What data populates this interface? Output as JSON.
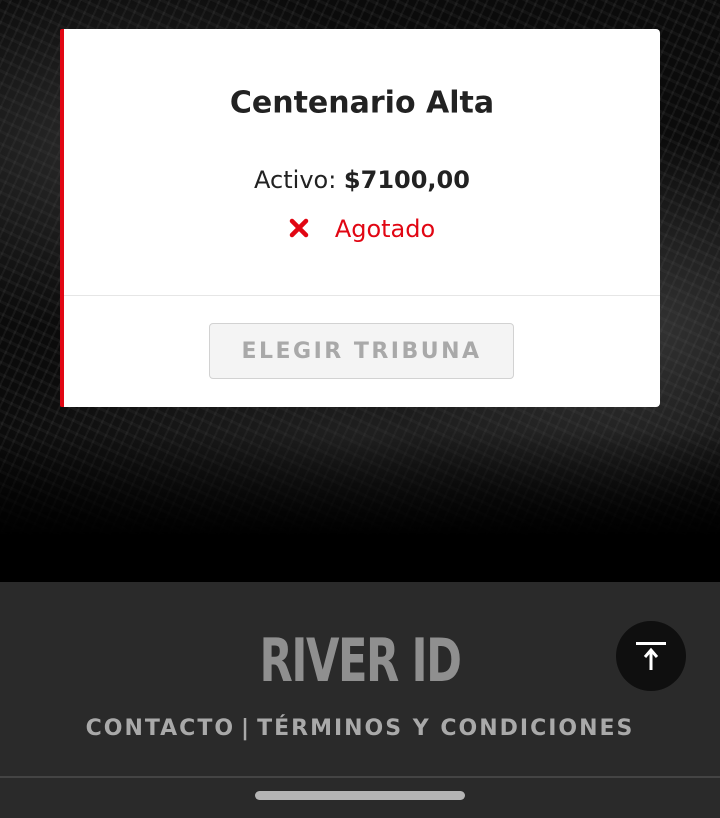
{
  "ticket": {
    "title": "Centenario Alta",
    "price_label": "Activo: ",
    "price_value": "$7100,00",
    "status_icon": "close-x-icon",
    "status_text": "Agotado",
    "action_label": "ELEGIR TRIBUNA"
  },
  "footer": {
    "logo_text": "RIVER ID",
    "contact_label": "CONTACTO",
    "separator": "|",
    "terms_label": "TÉRMINOS Y CONDICIONES",
    "scroll_top_icon": "arrow-up-to-top-icon"
  },
  "colors": {
    "accent_red": "#e10613",
    "footer_bg": "#2a2a2a"
  }
}
